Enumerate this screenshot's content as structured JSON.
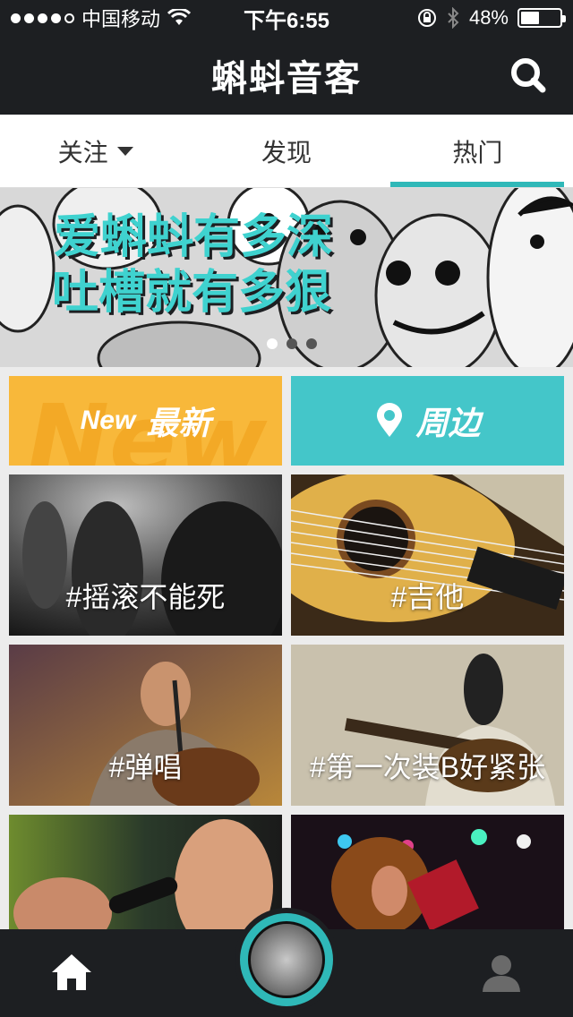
{
  "status_bar": {
    "carrier": "中国移动",
    "time": "下午6:55",
    "battery": "48%",
    "battery_level": 0.48,
    "signal_bars": 4,
    "icons": [
      "wifi-icon",
      "rotation-lock-icon",
      "bluetooth-icon",
      "battery-icon"
    ]
  },
  "header": {
    "logo": "蝌蚪音客",
    "search_icon": "search-icon"
  },
  "tabs": [
    {
      "label": "关注",
      "has_dropdown": true
    },
    {
      "label": "发现",
      "active": true
    },
    {
      "label": "热门"
    }
  ],
  "banner": {
    "line1": "爱蝌蚪有多深",
    "line2": "吐槽就有多狠",
    "page_count": 3,
    "active_page": 0
  },
  "quick_buttons": {
    "new": {
      "prefix": "New",
      "label": "最新",
      "color": "#f8b83a"
    },
    "nearby": {
      "label": "周边",
      "icon": "location-pin-icon",
      "color": "#44c6c9"
    }
  },
  "topics": [
    {
      "label": "#摇滚不能死"
    },
    {
      "label": "#吉他"
    },
    {
      "label": "#弹唱"
    },
    {
      "label": "#第一次装B好紧张"
    },
    {
      "label": ""
    },
    {
      "label": ""
    }
  ],
  "bottom_nav": {
    "home_icon": "home-icon",
    "record_icon": "record-knob-icon",
    "profile_icon": "person-icon",
    "accent": "#2fb8b8"
  }
}
